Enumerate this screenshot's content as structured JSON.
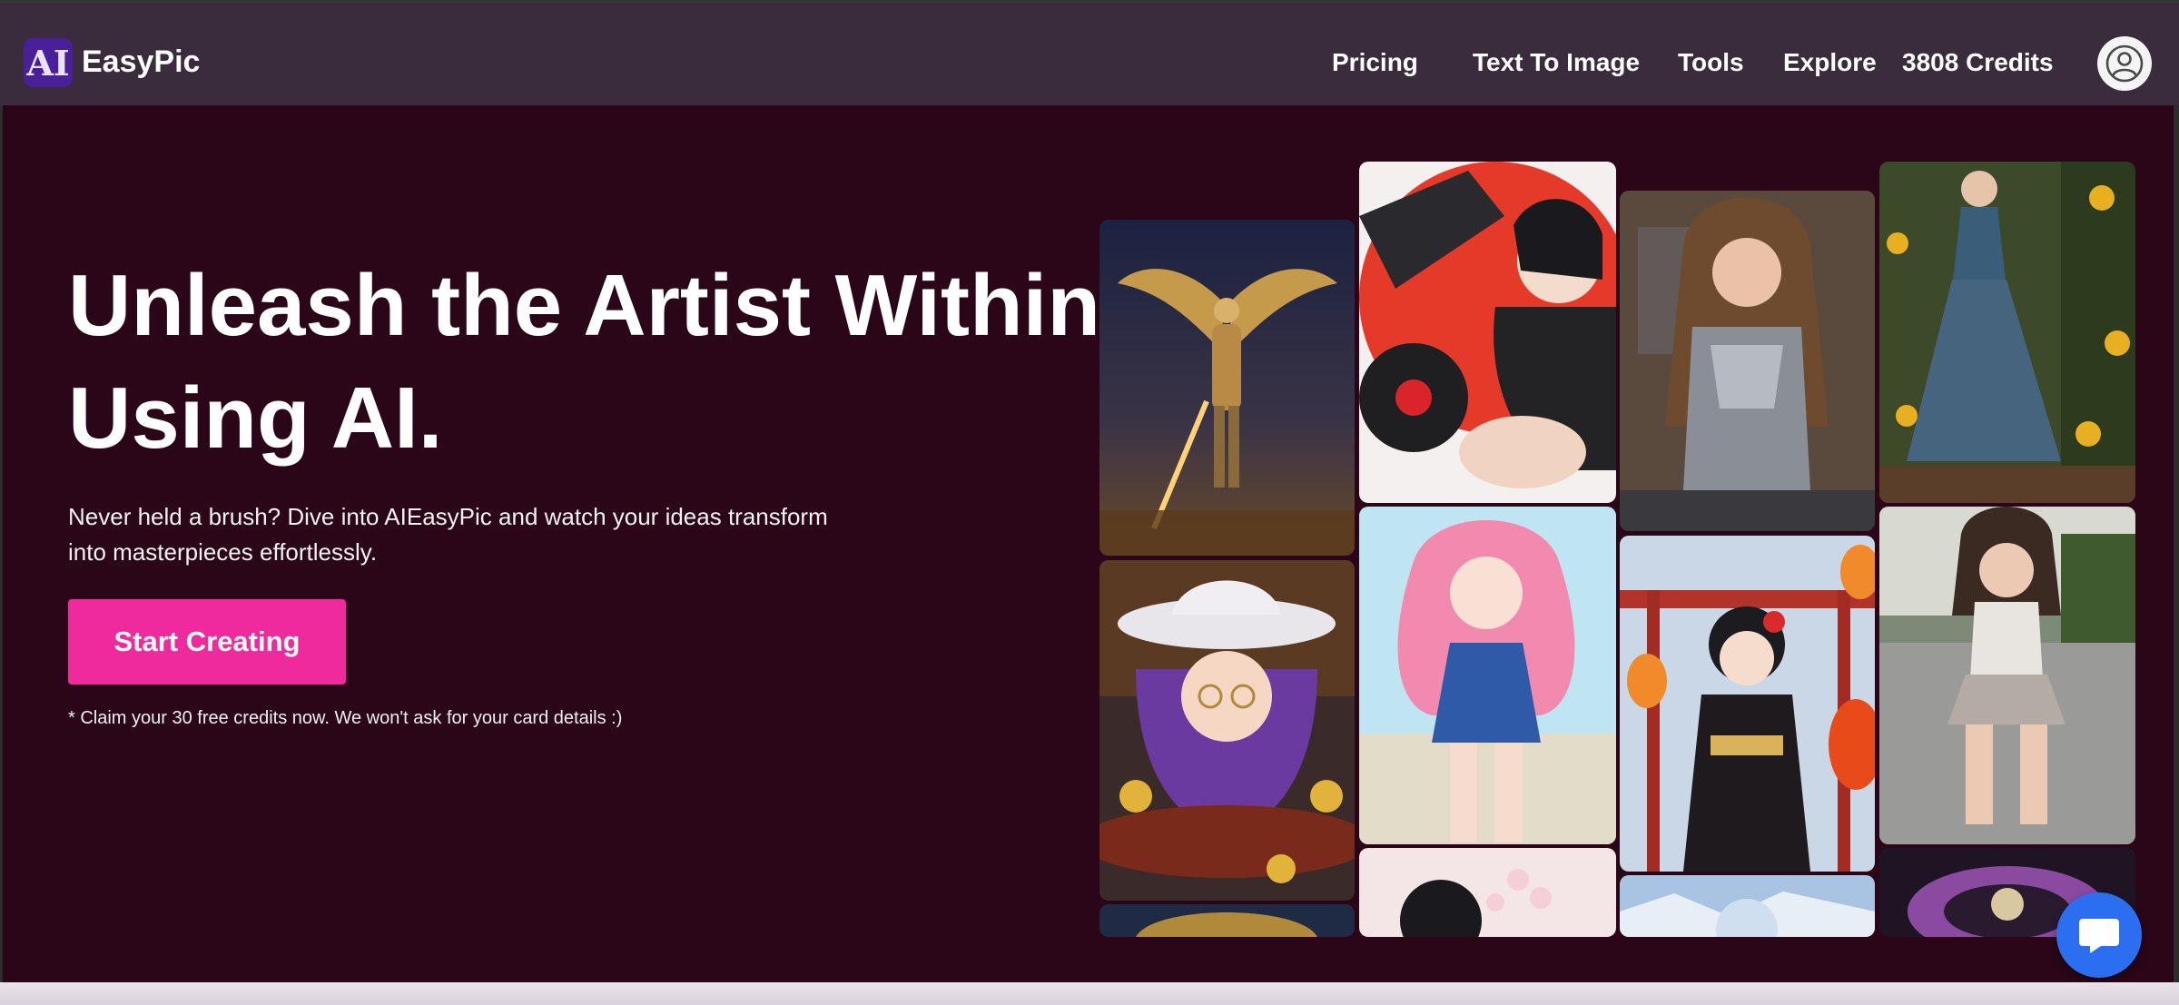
{
  "nav": {
    "brand_badge": "AI",
    "brand_name": "EasyPic",
    "links": [
      "Pricing",
      "Text To Image",
      "Tools",
      "Explore"
    ],
    "credits_value": "3808",
    "credits_label": "Credits"
  },
  "hero": {
    "title_line1": "Unleash the Artist Within",
    "title_line2": "Using AI.",
    "subtitle_line1": "Never held a brush? Dive into AIEasyPic and watch your ideas transform",
    "subtitle_line2": "into masterpieces effortlessly.",
    "cta_label": "Start Creating",
    "note": "* Claim your 30 free credits now. We won't ask for your card details :)"
  },
  "colors": {
    "background": "#2a0618",
    "navbar": "#3a2b3d",
    "cta": "#ee2a9d",
    "chat": "#2b6ff0"
  },
  "icons": {
    "avatar": "user-circle-icon",
    "chat": "chat-bubble-icon"
  }
}
